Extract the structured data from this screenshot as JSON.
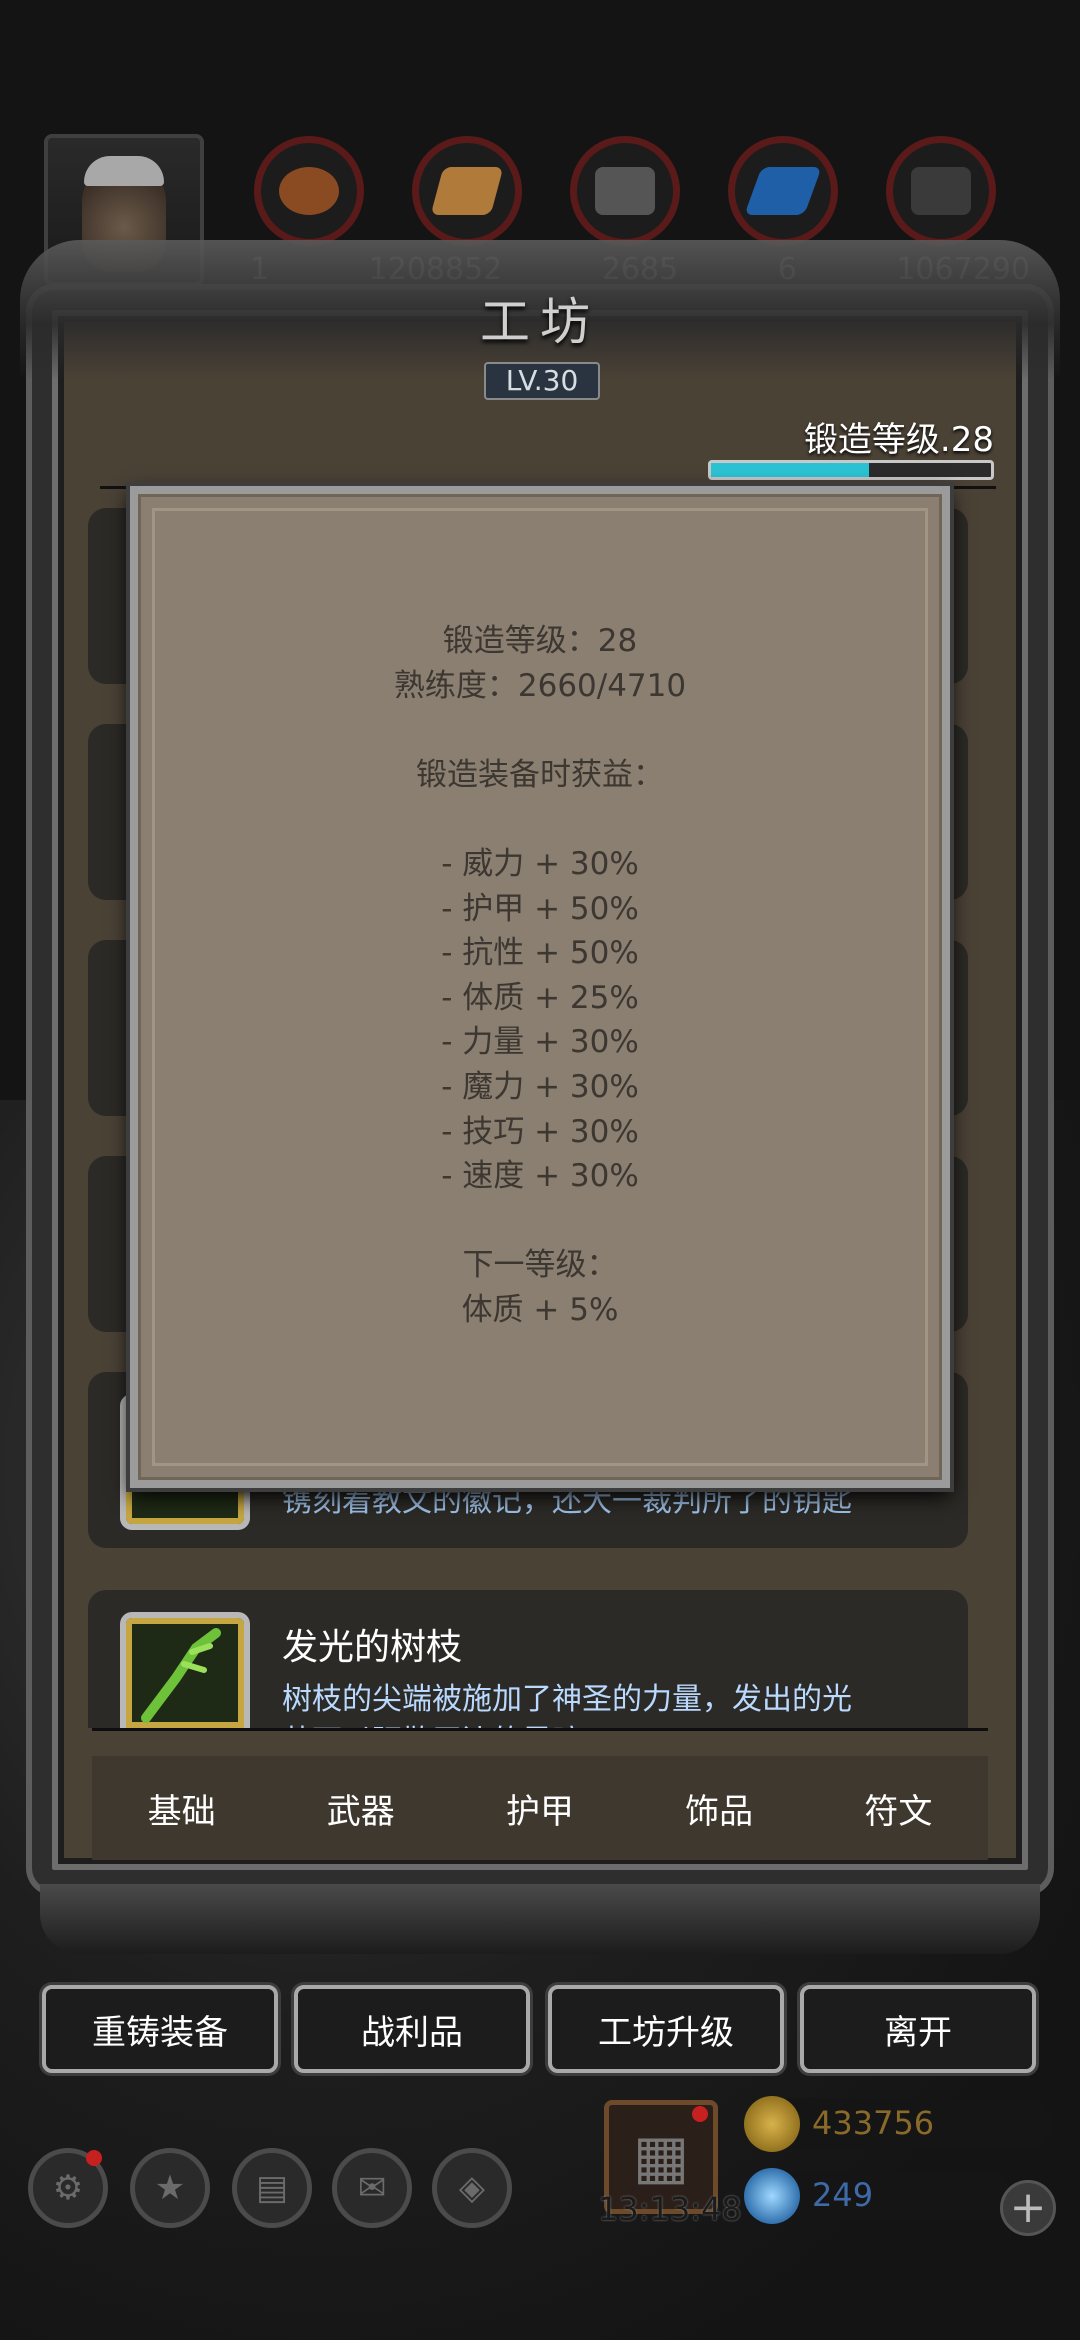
{
  "resources": {
    "values": [
      "1",
      "1208852",
      "2685",
      "6",
      "1067290"
    ]
  },
  "workshop": {
    "title": "工坊",
    "level": "LV.30",
    "forge_level_label": "锻造等级.28",
    "forge_progress": 0.565
  },
  "popup": {
    "line_level": "锻造等级：28",
    "line_proficiency": "熟练度：2660/4710",
    "benefits_heading": "锻造装备时获益：",
    "benefits": [
      "- 威力 + 30%",
      "- 护甲 + 50%",
      "- 抗性 + 50%",
      "- 体质 + 25%",
      "- 力量 + 30%",
      "- 魔力 + 30%",
      "- 技巧 + 30%",
      "- 速度 + 30%"
    ],
    "next_heading": "下一等级：",
    "next_benefit": "体质 + 5%"
  },
  "list": {
    "partial_desc": "镌刻着教文的徽记，还大一裁判所了的钥匙",
    "item_name": "发光的树枝",
    "item_desc_line1": "树枝的尖端被施加了神圣的力量，发出的光",
    "item_desc_line2": "芒可以驱散无边的黑暗"
  },
  "tabs": [
    "基础",
    "武器",
    "护甲",
    "饰品",
    "符文"
  ],
  "actions": {
    "reforge": "重铸装备",
    "loot": "战利品",
    "upgrade": "工坊升级",
    "leave": "离开"
  },
  "bottom": {
    "timer": "13:13:48",
    "gold": "433756",
    "gems": "249",
    "plus_symbol": "+"
  },
  "colors": {
    "accent_progress": "#2bc3d3",
    "gold_text": "#8a6a2a",
    "gem_text": "#3f6aa8"
  },
  "icons": [
    "settings-icon",
    "star-icon",
    "scroll-icon",
    "mail-icon",
    "rune-icon",
    "gift-icon",
    "gold-coin-icon",
    "gem-icon",
    "plus-icon"
  ]
}
